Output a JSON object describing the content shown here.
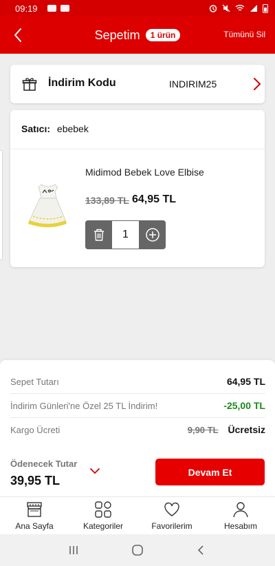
{
  "status_bar": {
    "time": "09:19"
  },
  "header": {
    "title": "Sepetim",
    "count_badge": "1 ürün",
    "clear_all": "Tümünü Sil",
    "color": "#dd0000"
  },
  "discount": {
    "label": "İndirim Kodu",
    "code": "INDIRIM25"
  },
  "cart": {
    "seller_label": "Satıcı:",
    "seller_name": "ebebek",
    "items": [
      {
        "name": "Midimod Bebek Love Elbise",
        "old_price": "133,89 TL",
        "price": "64,95 TL",
        "quantity": "1"
      }
    ]
  },
  "summary": {
    "subtotal_label": "Sepet Tutarı",
    "subtotal_value": "64,95 TL",
    "discount_label": "İndirim Günleri'ne Özel 25 TL İndirim!",
    "discount_value": "-25,00 TL",
    "shipping_label": "Kargo Ücreti",
    "shipping_old": "9,90 TL",
    "shipping_value": "Ücretsiz",
    "payable_label": "Ödenecek Tutar",
    "payable_value": "39,95 TL",
    "continue_label": "Devam Et",
    "accent": "#e60000",
    "discount_color": "#1a8a1a"
  },
  "bottom_nav": [
    {
      "label": "Ana Sayfa",
      "icon": "store-icon"
    },
    {
      "label": "Kategoriler",
      "icon": "grid-icon"
    },
    {
      "label": "Favorilerim",
      "icon": "heart-icon"
    },
    {
      "label": "Hesabım",
      "icon": "user-icon"
    }
  ]
}
